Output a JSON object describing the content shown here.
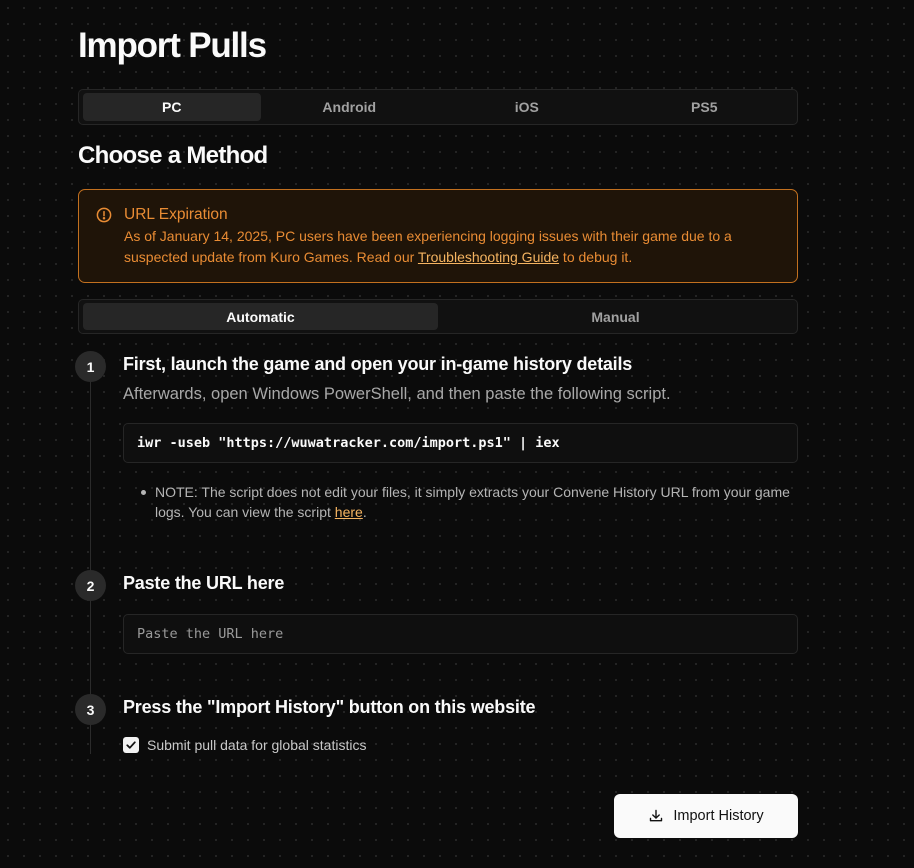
{
  "page": {
    "title": "Import Pulls"
  },
  "platform_tabs": [
    {
      "label": "PC",
      "active": true
    },
    {
      "label": "Android",
      "active": false
    },
    {
      "label": "iOS",
      "active": false
    },
    {
      "label": "PS5",
      "active": false
    }
  ],
  "section": {
    "title": "Choose a Method"
  },
  "alert": {
    "icon": "alert-circle-icon",
    "title": "URL Expiration",
    "body_before": "As of January 14, 2025, PC users have been experiencing logging issues with their game due to a suspected update from Kuro Games. Read our ",
    "link_text": "Troubleshooting Guide",
    "body_after": " to debug it.",
    "color": "#e98c34"
  },
  "method_tabs": [
    {
      "label": "Automatic",
      "active": true
    },
    {
      "label": "Manual",
      "active": false
    }
  ],
  "steps": [
    {
      "number": "1",
      "heading": "First, launch the game and open your in-game history details",
      "description": "Afterwards, open Windows PowerShell, and then paste the following script.",
      "code": "iwr -useb \"https://wuwatracker.com/import.ps1\" | iex",
      "note_before": "NOTE: The script does not edit your files, it simply extracts your Convene History URL from your game logs. You can view the script ",
      "note_link": "here",
      "note_after": "."
    },
    {
      "number": "2",
      "heading": "Paste the URL here",
      "input_placeholder": "Paste the URL here",
      "input_value": ""
    },
    {
      "number": "3",
      "heading": "Press the \"Import History\" button on this website",
      "checkbox_label": "Submit pull data for global statistics",
      "checkbox_checked": true
    }
  ],
  "import_button": {
    "label": "Import History",
    "icon": "download-icon"
  }
}
